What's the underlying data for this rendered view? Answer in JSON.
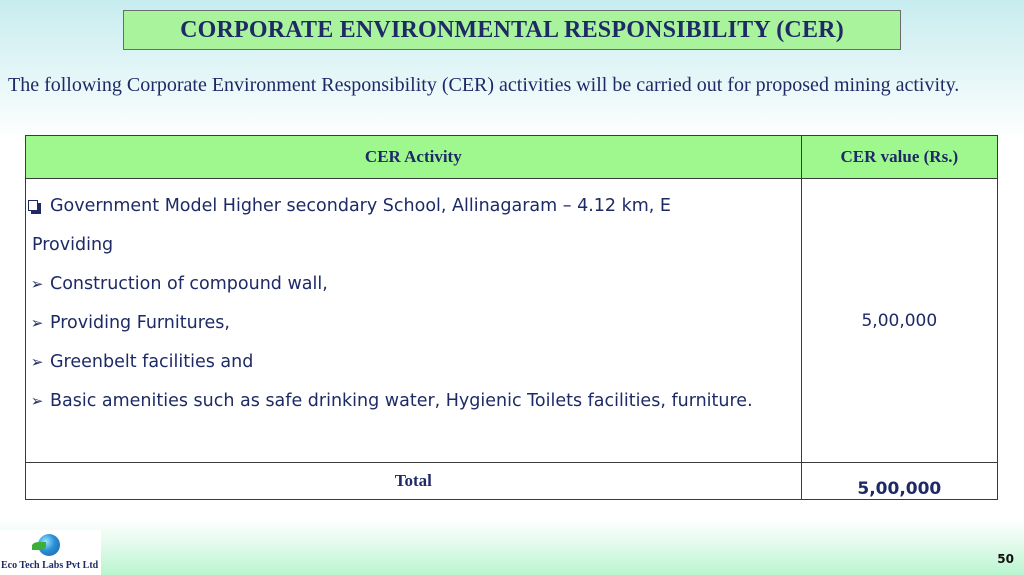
{
  "title": "CORPORATE ENVIRONMENTAL RESPONSIBILITY (CER)",
  "intro": "The following Corporate Environment Responsibility (CER) activities will be carried out for proposed mining activity.",
  "table": {
    "headers": {
      "activity": "CER Activity",
      "value": "CER value (Rs.)"
    },
    "lines": [
      {
        "bullet": "square",
        "text": "Government Model Higher secondary School, Allinagaram – 4.12 km, E"
      },
      {
        "bullet": "none",
        "text": "Providing"
      },
      {
        "bullet": "arrow",
        "text": "Construction of compound wall,"
      },
      {
        "bullet": "arrow",
        "text": "Providing  Furnitures,"
      },
      {
        "bullet": "arrow",
        "text": "Greenbelt facilities and"
      },
      {
        "bullet": "arrow",
        "text": "Basic amenities such as safe drinking water, Hygienic Toilets facilities, furniture."
      }
    ],
    "value": "5,00,000",
    "total_label": "Total",
    "total_value": "5,00,000"
  },
  "footer": {
    "logo_text": "Eco Tech Labs Pvt Ltd",
    "page_number": "50"
  }
}
